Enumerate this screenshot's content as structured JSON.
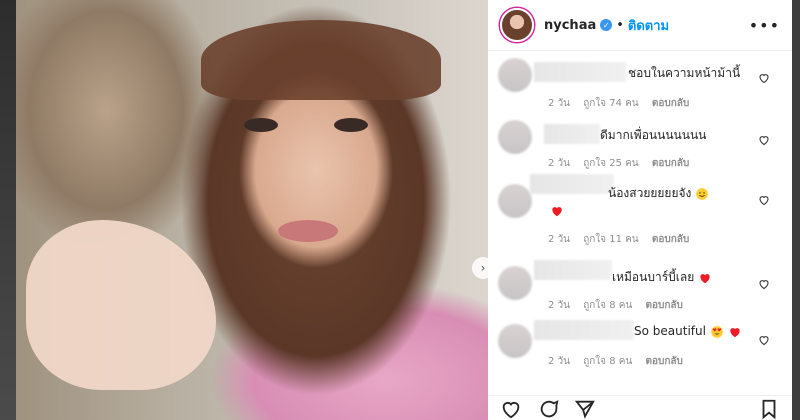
{
  "post": {
    "username": "nychaa",
    "follow_label": "ติดตาม",
    "separator": "•",
    "more_label": "•••"
  },
  "comments": [
    {
      "text": "ชอบในความหน้าม้านี้",
      "time": "2 วัน",
      "likes": "ถูกใจ 74 คน",
      "reply": "ตอบกลับ",
      "emojis": []
    },
    {
      "text": "ดีมากเพื่อนนนนนนน",
      "time": "2 วัน",
      "likes": "ถูกใจ 25 คน",
      "reply": "ตอบกลับ",
      "emojis": []
    },
    {
      "text": "น้องสวยยยยยจัง",
      "time": "2 วัน",
      "likes": "ถูกใจ 11 คน",
      "reply": "ตอบกลับ",
      "emojis": [
        "smiling-face",
        "red-heart"
      ]
    },
    {
      "text": "เหมือนบาร์บี้เลย",
      "time": "2 วัน",
      "likes": "ถูกใจ 8 คน",
      "reply": "ตอบกลับ",
      "emojis": [
        "red-heart"
      ]
    },
    {
      "text": "So beautiful",
      "time": "2 วัน",
      "likes": "ถูกใจ 8 คน",
      "reply": "ตอบกลับ",
      "emojis": [
        "heart-eyes-face",
        "red-heart"
      ]
    }
  ],
  "colors": {
    "accent": "#0095f6",
    "heart": "#ed1c24",
    "meta": "#8e8e8e"
  },
  "icons": [
    "verified-badge-icon",
    "more-options-icon",
    "heart-outline-icon",
    "next-arrow-icon",
    "comment-icon",
    "share-icon",
    "bookmark-icon"
  ]
}
